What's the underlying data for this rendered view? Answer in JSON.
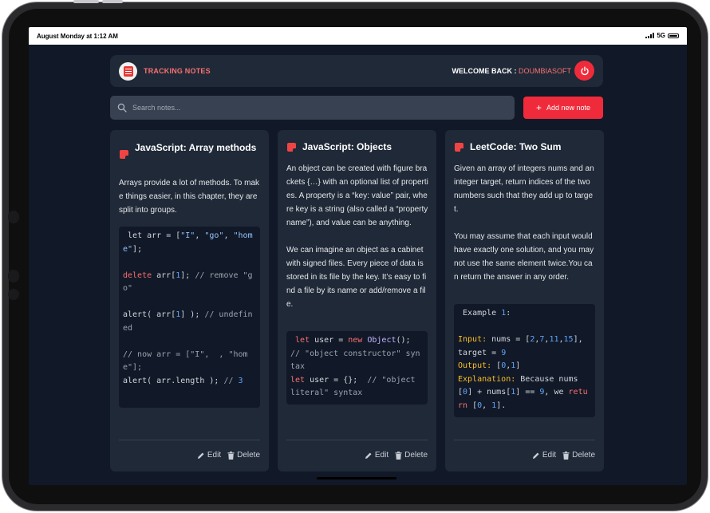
{
  "status_bar": {
    "time": "August Monday at 1:12 AM",
    "network": "5G"
  },
  "header": {
    "app_title": "TRACKING NOTES",
    "welcome_label": "WELCOME BACK : ",
    "username": "DOUMBIASOFT"
  },
  "search": {
    "placeholder": "Search notes...",
    "value": ""
  },
  "add_button": {
    "label": "Add new note"
  },
  "colors": {
    "accent": "#ef2b3b",
    "background": "#111827",
    "card": "#1f2937",
    "input": "#374151"
  },
  "notes": [
    {
      "title": "JavaScript: Array methods",
      "body": "Arrays provide a lot of methods. To make things easier, in this chapter, they are split into groups.",
      "code": " let arr = [\"I\", \"go\", \"home\"];\n\ndelete arr[1]; // remove \"go\"\n\nalert( arr[1] ); // undefined\n\n// now arr = [\"I\",  , \"home\"];\nalert( arr.length ); // 3",
      "edit_label": "Edit",
      "delete_label": "Delete"
    },
    {
      "title": "JavaScript: Objects",
      "body": "An object can be created with figure brackets {…} with an optional list of properties. A property is a “key: value” pair, where key is a string (also called a “property name”), and value can be anything.\n\nWe can imagine an object as a cabinet with signed files. Every piece of data is stored in its file by the key. It’s easy to find a file by its name or add/remove a file.",
      "code": " let user = new Object(); // \"object constructor\" syntax\nlet user = {};  // \"object literal\" syntax",
      "edit_label": "Edit",
      "delete_label": "Delete"
    },
    {
      "title": "LeetCode: Two Sum",
      "body": "Given an array of integers nums and an integer target, return indices of the two numbers such that they add up to target.\n\nYou may assume that each input would have exactly one solution, and you may not use the same element twice.You can return the answer in any order.",
      "code": " Example 1:\n\nInput: nums = [2,7,11,15], target = 9\nOutput: [0,1]\nExplanation: Because nums[0] + nums[1] == 9, we return [0, 1].",
      "edit_label": "Edit",
      "delete_label": "Delete"
    }
  ]
}
